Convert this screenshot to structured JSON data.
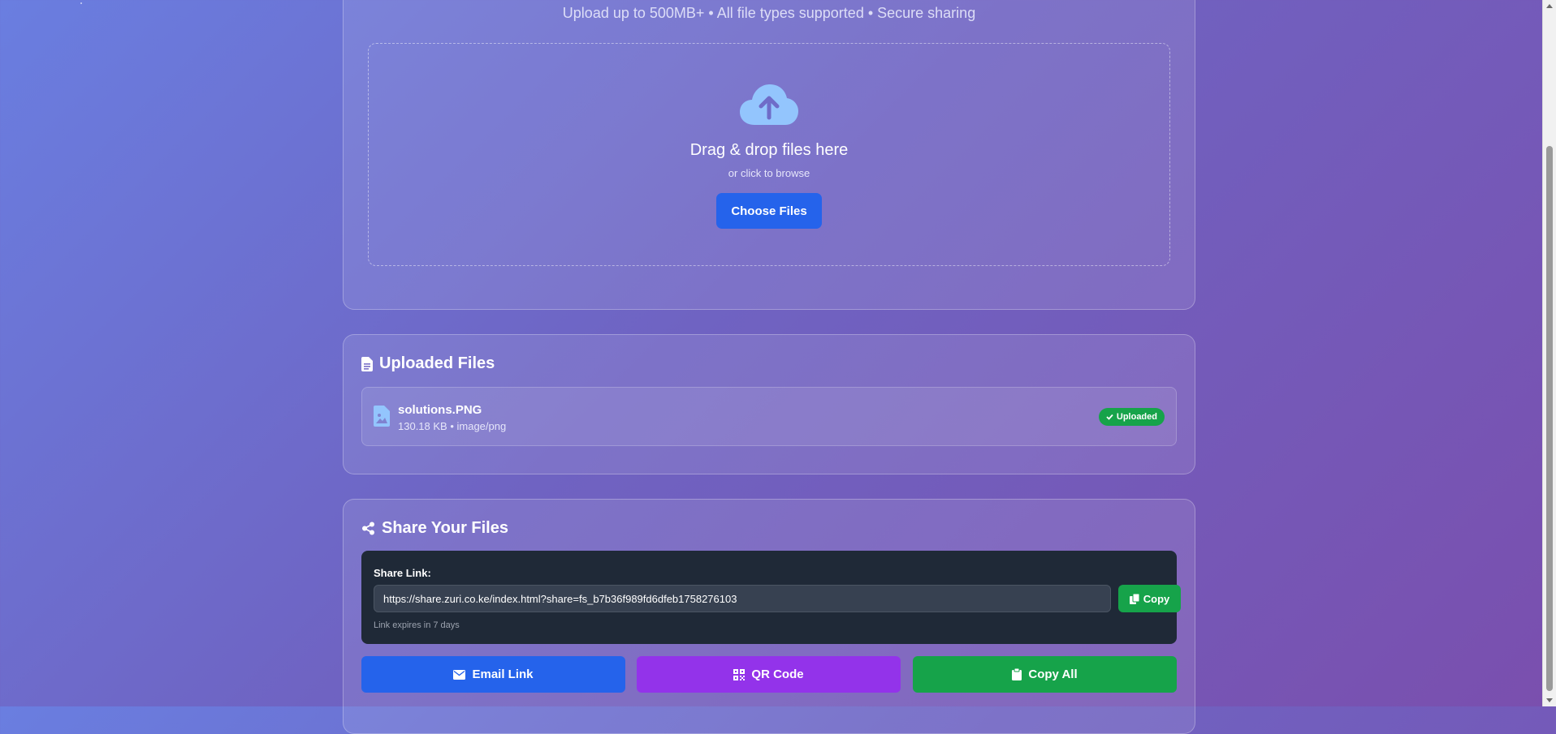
{
  "header": {
    "tagline": "Upload up to 500MB+ • All file types supported • Secure sharing"
  },
  "dropzone": {
    "icon": "cloud-upload-icon",
    "title": "Drag & drop files here",
    "subtitle": "or click to browse",
    "button_label": "Choose Files"
  },
  "uploaded": {
    "title": "Uploaded Files",
    "icon": "file-icon",
    "files": [
      {
        "name": "solutions.PNG",
        "meta": "130.18 KB • image/png",
        "status": "Uploaded",
        "icon": "image-file-icon"
      }
    ]
  },
  "share": {
    "title": "Share Your Files",
    "icon": "share-icon",
    "link_label": "Share Link:",
    "link_value": "https://share.zuri.co.ke/index.html?share=fs_b7b36f989fd6dfeb1758276103",
    "copy_label": "Copy",
    "expiry": "Link expires in 7 days",
    "actions": {
      "email": "Email Link",
      "qr": "QR Code",
      "copy_all": "Copy All"
    }
  },
  "colors": {
    "primary": "#2563eb",
    "success": "#16a34a",
    "purple": "#9333ea",
    "panel_dark": "#1f2937",
    "upload_icon": "#93c5fd"
  }
}
